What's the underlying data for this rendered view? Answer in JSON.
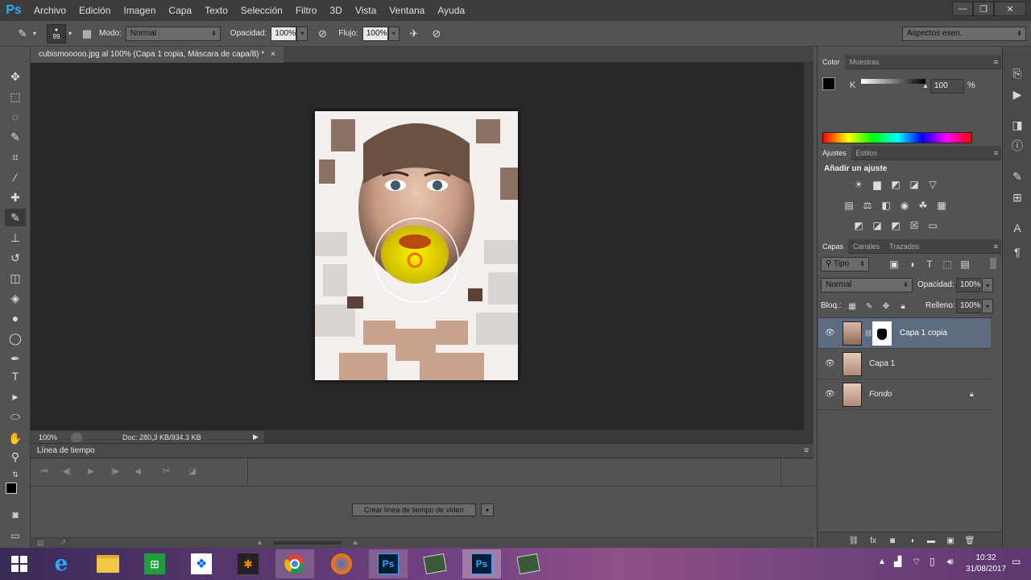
{
  "menubar": {
    "logo": "Ps",
    "items": [
      "Archivo",
      "Edición",
      "Imagen",
      "Capa",
      "Texto",
      "Selección",
      "Filtro",
      "3D",
      "Vista",
      "Ventana",
      "Ayuda"
    ]
  },
  "options": {
    "brush_size": "99",
    "mode_label": "Modo:",
    "mode_value": "Normal",
    "opacity_label": "Opacidad:",
    "opacity_value": "100%",
    "flow_label": "Flujo:",
    "flow_value": "100%",
    "workspace": "Aspectos esen."
  },
  "document": {
    "tab_title": "cubismooooo.jpg al 100% (Capa 1 copia, Máscara de capa/8) *",
    "close": "×",
    "zoom": "100%",
    "doc_info": "Doc: 280,3 KB/934,3 KB"
  },
  "timeline": {
    "title": "Línea de tiempo",
    "create_button": "Crear línea de tiempo de vídeo"
  },
  "color_panel": {
    "tabs": [
      "Color",
      "Muestras"
    ],
    "channel": "K",
    "value": "100",
    "unit": "%"
  },
  "adjust_panel": {
    "tabs": [
      "Ajustes",
      "Estilos"
    ],
    "heading": "Añadir un ajuste"
  },
  "layers_panel": {
    "tabs": [
      "Capas",
      "Canales",
      "Trazados"
    ],
    "filter_kind": "Tipo",
    "blend_mode": "Normal",
    "opacity_label": "Opacidad:",
    "opacity_value": "100%",
    "lock_label": "Bloq.:",
    "fill_label": "Relleno:",
    "fill_value": "100%",
    "layers": [
      {
        "name": "Capa 1 copia"
      },
      {
        "name": "Capa 1"
      },
      {
        "name": "Fondo"
      }
    ]
  },
  "taskbar": {
    "time": "10:32",
    "date": "31/08/2017",
    "ps_label": "Ps"
  }
}
